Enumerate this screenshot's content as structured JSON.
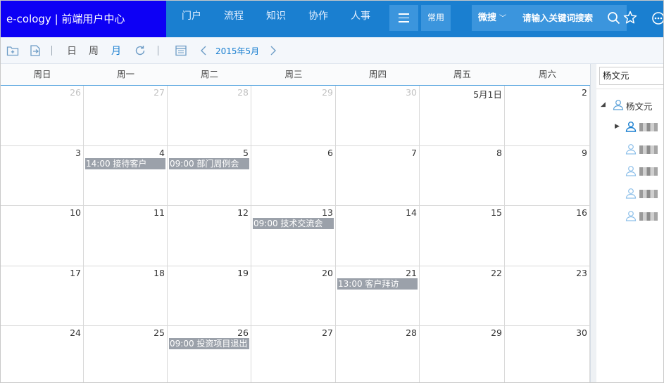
{
  "app": {
    "brand": "e-cology | 前端用户中心",
    "nav": [
      "门户",
      "流程",
      "知识",
      "协作",
      "人事"
    ],
    "common_label": "常用",
    "search_type": "微搜",
    "search_placeholder": "请输入关键词搜索"
  },
  "toolbar": {
    "day_label": "日",
    "week_label": "周",
    "month_label": "月",
    "date_label": "2015年5月"
  },
  "calendar": {
    "weekdays": [
      "周日",
      "周一",
      "周二",
      "周三",
      "周四",
      "周五",
      "周六"
    ],
    "weeks": [
      [
        {
          "day": "26",
          "other": true
        },
        {
          "day": "27",
          "other": true
        },
        {
          "day": "28",
          "other": true
        },
        {
          "day": "29",
          "other": true
        },
        {
          "day": "30",
          "other": true
        },
        {
          "day": "5月1日"
        },
        {
          "day": "2"
        }
      ],
      [
        {
          "day": "3"
        },
        {
          "day": "4",
          "event": "14:00 接待客户"
        },
        {
          "day": "5",
          "event": "09:00 部门周例会"
        },
        {
          "day": "6"
        },
        {
          "day": "7"
        },
        {
          "day": "8"
        },
        {
          "day": "9"
        }
      ],
      [
        {
          "day": "10"
        },
        {
          "day": "11"
        },
        {
          "day": "12"
        },
        {
          "day": "13",
          "event": "09:00 技术交流会"
        },
        {
          "day": "14"
        },
        {
          "day": "15"
        },
        {
          "day": "16"
        }
      ],
      [
        {
          "day": "17"
        },
        {
          "day": "18"
        },
        {
          "day": "19"
        },
        {
          "day": "20"
        },
        {
          "day": "21",
          "event": "13:00 客户拜访"
        },
        {
          "day": "22"
        },
        {
          "day": "23"
        }
      ],
      [
        {
          "day": "24"
        },
        {
          "day": "25"
        },
        {
          "day": "26",
          "event": "09:00 投资项目退出"
        },
        {
          "day": "27"
        },
        {
          "day": "28"
        },
        {
          "day": "29"
        },
        {
          "day": "30"
        }
      ]
    ]
  },
  "side": {
    "search_value": "杨文元",
    "root_label": "杨文元"
  },
  "colors": {
    "topbar": "#1a7fd0",
    "brand_bg": "#0d00f5",
    "event_bg": "#9ba1aa",
    "accent": "#1a7fd0"
  }
}
